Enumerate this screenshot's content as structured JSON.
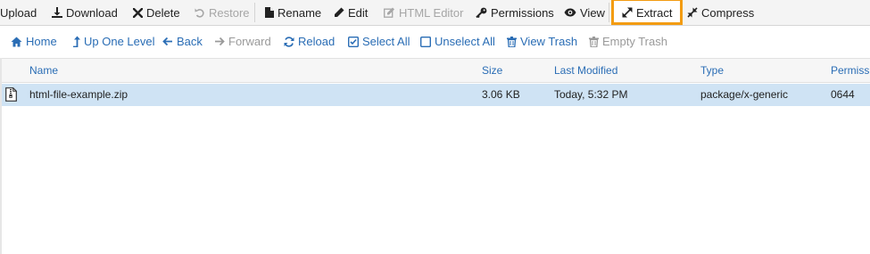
{
  "toolbar": {
    "upload": "Upload",
    "download": "Download",
    "delete": "Delete",
    "restore": "Restore",
    "rename": "Rename",
    "edit": "Edit",
    "html_editor": "HTML Editor",
    "permissions": "Permissions",
    "view": "View",
    "extract": "Extract",
    "compress": "Compress",
    "highlight_color": "#f39c12"
  },
  "nav": {
    "home": "Home",
    "up_one_level": "Up One Level",
    "back": "Back",
    "forward": "Forward",
    "reload": "Reload",
    "select_all": "Select All",
    "unselect_all": "Unselect All",
    "view_trash": "View Trash",
    "empty_trash": "Empty Trash"
  },
  "table": {
    "columns": {
      "name": "Name",
      "size": "Size",
      "last_modified": "Last Modified",
      "type": "Type",
      "permissions": "Permissions"
    },
    "rows": [
      {
        "name": "html-file-example.zip",
        "size": "3.06 KB",
        "last_modified": "Today, 5:32 PM",
        "type": "package/x-generic",
        "permissions": "0644",
        "icon": "zip-file-icon",
        "selected": true
      }
    ]
  },
  "colors": {
    "link": "#2a6db5",
    "selected_row": "#cfe3f4",
    "toolbar_bg": "#f4f4f4"
  }
}
